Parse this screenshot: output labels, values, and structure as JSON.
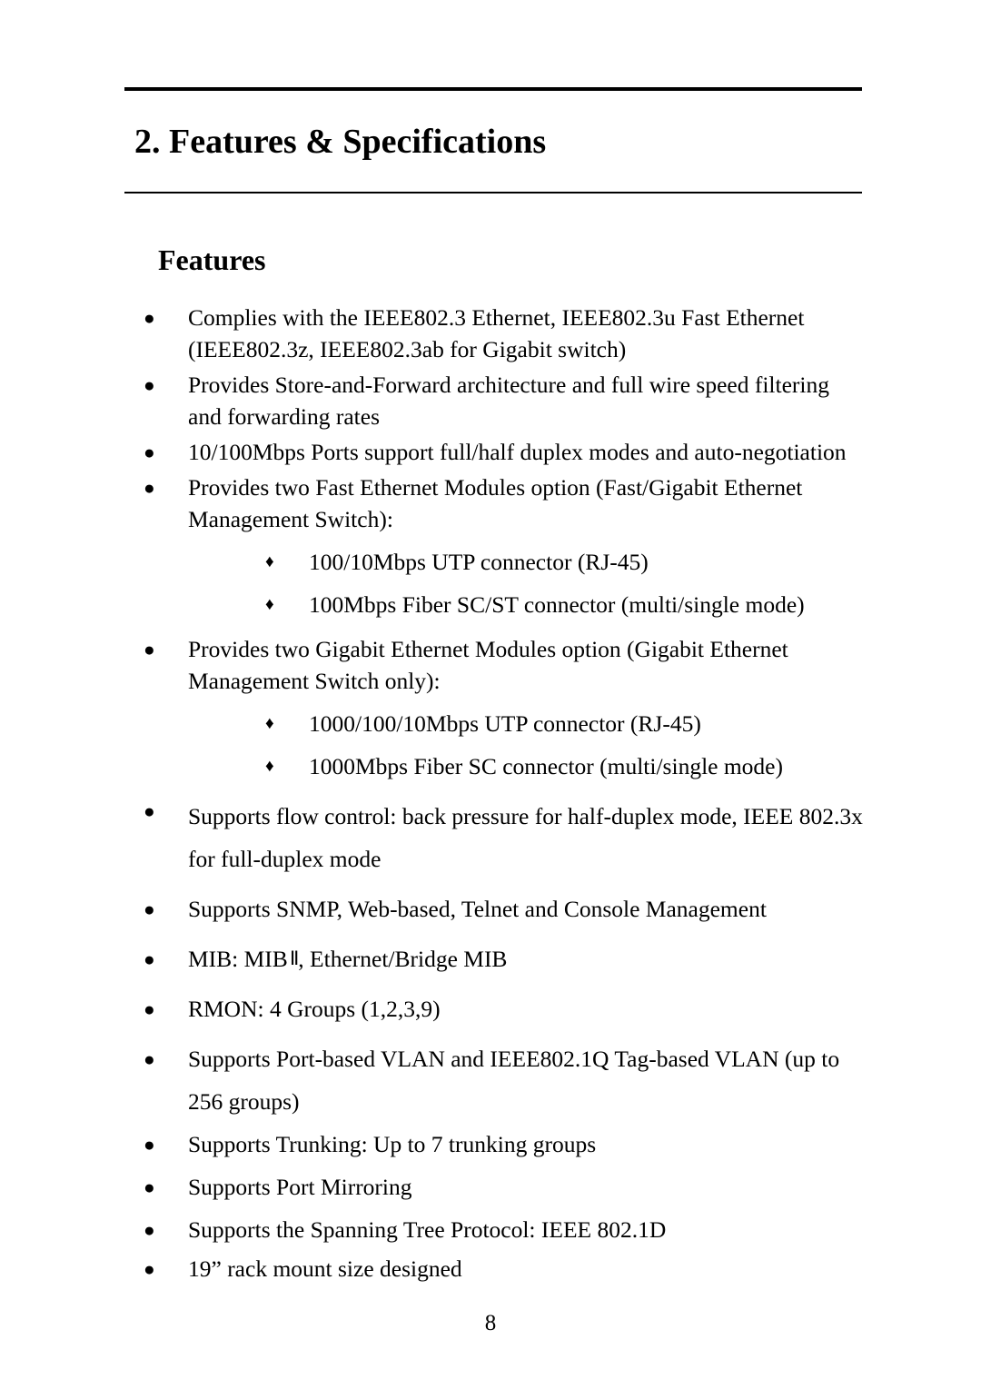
{
  "document": {
    "chapter_title": "2. Features & Specifications",
    "section_title": "Features",
    "page_number": "8",
    "bullet_glyph": "●",
    "sub_bullet_glyph": "♦",
    "features": [
      {
        "text": "Complies with the IEEE802.3 Ethernet, IEEE802.3u Fast Ethernet (IEEE802.3z, IEEE802.3ab for Gigabit switch)",
        "subs": []
      },
      {
        "text": "Provides Store-and-Forward architecture and full wire speed filtering and forwarding rates",
        "subs": []
      },
      {
        "text": "10/100Mbps Ports support full/half duplex modes and auto-negotiation",
        "subs": []
      },
      {
        "text": "Provides two Fast Ethernet Modules option (Fast/Gigabit Ethernet Management Switch):",
        "subs": [
          "100/10Mbps UTP connector (RJ-45)",
          "100Mbps Fiber SC/ST connector (multi/single mode)"
        ]
      },
      {
        "text": "Provides two Gigabit Ethernet Modules option (Gigabit Ethernet Management Switch only):",
        "subs": [
          "1000/100/10Mbps UTP connector (RJ-45)",
          "1000Mbps Fiber SC connector (multi/single mode)"
        ]
      },
      {
        "text": "Supports flow control: back pressure for half-duplex mode, IEEE 802.3x for full-duplex mode",
        "subs": []
      },
      {
        "text": "Supports SNMP, Web-based, Telnet and Console Management",
        "subs": []
      },
      {
        "text": "MIB: MIB Ⅱ, Ethernet/Bridge MIB",
        "subs": []
      },
      {
        "text": "RMON: 4 Groups (1,2,3,9)",
        "subs": []
      },
      {
        "text": "Supports Port-based VLAN and IEEE802.1Q Tag-based VLAN (up to 256 groups)",
        "subs": []
      },
      {
        "text": "Supports Trunking: Up to 7 trunking groups",
        "subs": []
      },
      {
        "text": "Supports Port Mirroring",
        "subs": []
      },
      {
        "text": "Supports the Spanning Tree Protocol: IEEE 802.1D",
        "subs": []
      },
      {
        "text": "19” rack mount size designed",
        "subs": []
      }
    ]
  }
}
